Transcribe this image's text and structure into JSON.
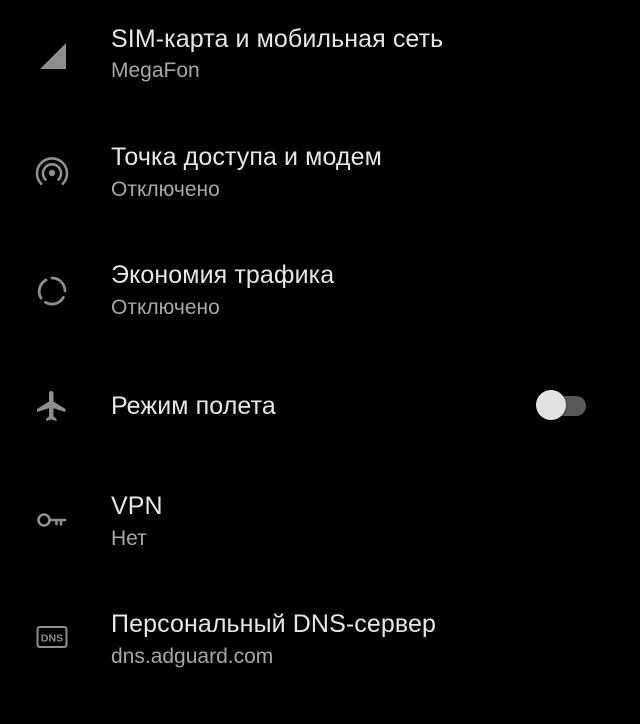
{
  "settings": {
    "items": [
      {
        "id": "sim",
        "title": "SIM-карта и мобильная сеть",
        "subtitle": "MegaFon",
        "icon": "cellular-signal-icon"
      },
      {
        "id": "hotspot",
        "title": "Точка доступа и модем",
        "subtitle": "Отключено",
        "icon": "hotspot-icon"
      },
      {
        "id": "data-saver",
        "title": "Экономия трафика",
        "subtitle": "Отключено",
        "icon": "data-saver-icon"
      },
      {
        "id": "airplane",
        "title": "Режим полета",
        "icon": "airplane-icon",
        "toggle_on": false
      },
      {
        "id": "vpn",
        "title": "VPN",
        "subtitle": "Нет",
        "icon": "key-icon"
      },
      {
        "id": "dns",
        "title": "Персональный DNS-сервер",
        "subtitle": "dns.adguard.com",
        "icon": "dns-icon",
        "icon_text": "DNS"
      }
    ]
  },
  "colors": {
    "background": "#000000",
    "title": "#e6e6e6",
    "subtitle": "#a6a6a6",
    "icon": "#8e8e8e",
    "toggle_track": "#5a5a5a",
    "toggle_thumb": "#e2e2e2"
  }
}
